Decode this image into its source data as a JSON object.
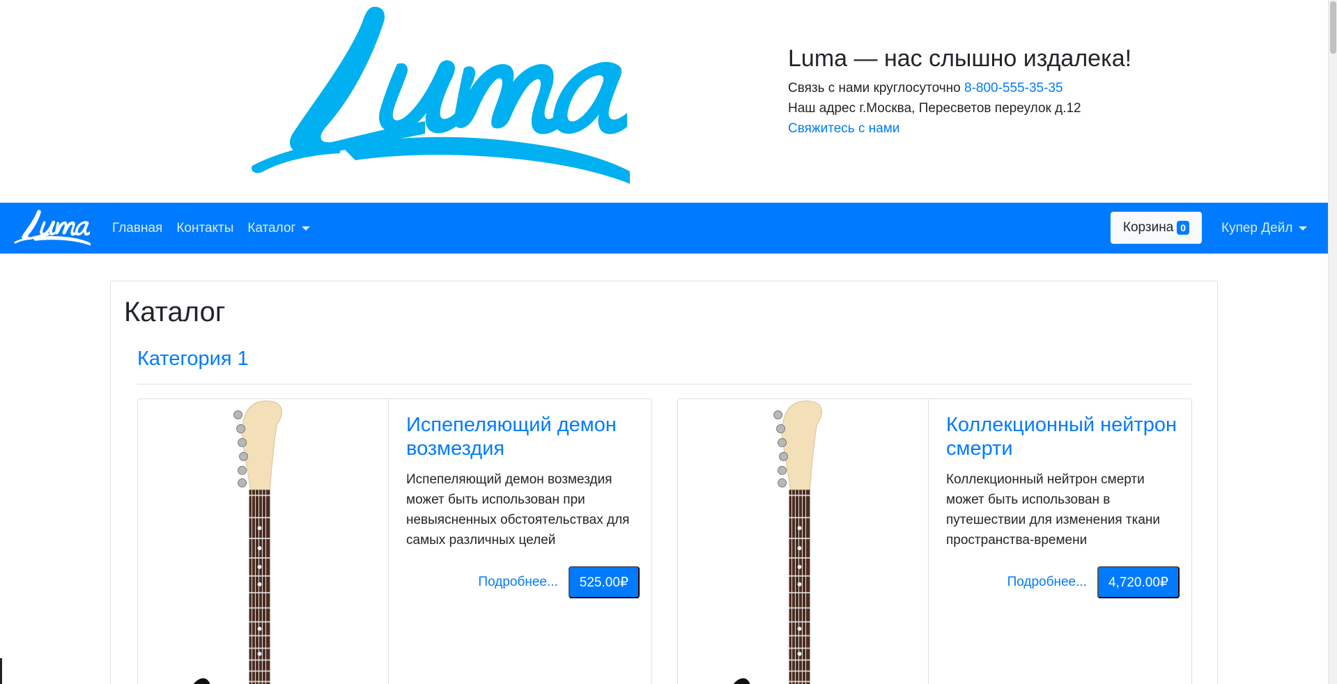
{
  "header": {
    "logo_text": "Luma",
    "tagline": "Luma — нас слышно издалека!",
    "contact_prefix": "Связь с нами круглосуточно",
    "phone": "8-800-555-35-35",
    "address": "Наш адрес г.Москва, Пересветов переулок д.12",
    "contact_link": "Свяжитесь с нами"
  },
  "navbar": {
    "logo_text": "Luma",
    "links": [
      {
        "label": "Главная"
      },
      {
        "label": "Контакты"
      },
      {
        "label": "Каталог"
      }
    ],
    "cart_label": "Корзина",
    "cart_count": "0",
    "user_name": "Купер Дейл"
  },
  "catalog": {
    "title": "Каталог",
    "category": "Категория 1",
    "products": [
      {
        "name": "Испепеляющий демон возмездия",
        "description": "Испепеляющий демон возмездия может быть использован при невыясненных обстоятельствах для самых различных целей",
        "more": "Подробнее...",
        "price": "525.00₽"
      },
      {
        "name": "Коллекционный нейтрон смерти",
        "description": "Коллекционный нейтрон смерти может быть использован в путешествии для изменения ткани пространства-времени",
        "more": "Подробнее...",
        "price": "4,720.00₽"
      }
    ]
  },
  "colors": {
    "brand_blue": "#007bff",
    "logo_cyan": "#00b0f0",
    "text": "#212529"
  },
  "icons": [
    "luma-logo",
    "nav-logo",
    "chevron-down-icon",
    "guitar-image"
  ]
}
